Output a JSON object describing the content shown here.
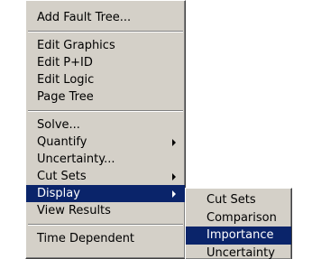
{
  "main_menu": {
    "add_fault_tree": "Add Fault Tree...",
    "edit_graphics": "Edit Graphics",
    "edit_pid": "Edit P+ID",
    "edit_logic": "Edit Logic",
    "page_tree": "Page Tree",
    "solve": "Solve...",
    "quantify": "Quantify",
    "uncertainty": "Uncertainty...",
    "cut_sets": "Cut Sets",
    "display": "Display",
    "view_results": "View Results",
    "time_dependent": "Time Dependent"
  },
  "display_submenu": {
    "items": [
      "Cut Sets",
      "Comparison",
      "Importance",
      "Uncertainty"
    ],
    "highlighted": "Importance"
  },
  "colors": {
    "menu_background": "#d4d0c8",
    "highlight": "#0a246a",
    "highlight_text": "#ffffff"
  },
  "icons": {
    "submenu_arrow": "arrow-right-icon"
  }
}
